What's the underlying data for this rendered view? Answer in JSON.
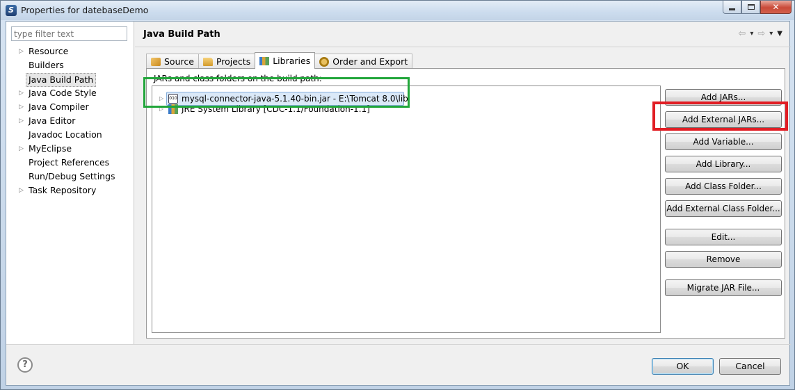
{
  "window": {
    "title": "Properties for datebaseDemo",
    "close_glyph": "✕"
  },
  "left": {
    "filter_placeholder": "type filter text",
    "tree": [
      {
        "label": "Resource",
        "expandable": true
      },
      {
        "label": "Builders",
        "expandable": false
      },
      {
        "label": "Java Build Path",
        "expandable": false,
        "selected": true
      },
      {
        "label": "Java Code Style",
        "expandable": true
      },
      {
        "label": "Java Compiler",
        "expandable": true
      },
      {
        "label": "Java Editor",
        "expandable": true
      },
      {
        "label": "Javadoc Location",
        "expandable": false
      },
      {
        "label": "MyEclipse",
        "expandable": true
      },
      {
        "label": "Project References",
        "expandable": false
      },
      {
        "label": "Run/Debug Settings",
        "expandable": false
      },
      {
        "label": "Task Repository",
        "expandable": true
      }
    ]
  },
  "page": {
    "title": "Java Build Path",
    "tabs": [
      {
        "label": "Source"
      },
      {
        "label": "Projects"
      },
      {
        "label": "Libraries",
        "active": true
      },
      {
        "label": "Order and Export"
      }
    ],
    "panel_label": "JARs and class folders on the build path:",
    "libraries": [
      {
        "label": "mysql-connector-java-5.1.40-bin.jar - E:\\Tomcat 8.0\\lib",
        "selected": true
      },
      {
        "label": "JRE System Library [CDC-1.1/Foundation-1.1]"
      }
    ],
    "buttons": [
      "Add JARs...",
      "Add External JARs...",
      "Add Variable...",
      "Add Library...",
      "Add Class Folder...",
      "Add External Class Folder...",
      "Edit...",
      "Remove",
      "Migrate JAR File..."
    ]
  },
  "footer": {
    "help_glyph": "?",
    "ok_label": "OK",
    "cancel_label": "Cancel"
  },
  "annotations": {
    "green_box_color": "#21a63a",
    "red_box_color": "#e11d24"
  }
}
